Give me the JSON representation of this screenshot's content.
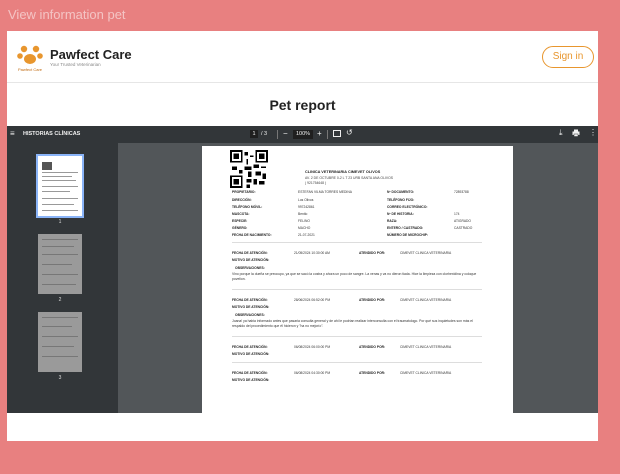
{
  "top_bar": {
    "title": "View information pet"
  },
  "header": {
    "brand": "Pawfect Care",
    "tagline": "Your Trusted Veterinarian",
    "logo_text": "Pawfect Care",
    "sign_in": "Sign in"
  },
  "page": {
    "heading": "Pet report"
  },
  "viewer": {
    "title": "HISTORIAS CLÍNICAS",
    "current_page": "1",
    "page_count": "/ 3",
    "zoom": "100%",
    "thumbs": [
      "1",
      "2",
      "3"
    ]
  },
  "doc": {
    "clinic": "CLINICA VETERINARIA CIMEVET OLIVOS",
    "address": "AV. 2 DE OCTUBRE 0-2 L T 23 URB SANTA ANA OLIVOS",
    "phone": "( 921754648 )",
    "left_fields": [
      {
        "label": "PROPIETARIO:",
        "value": "ESTEFAN VILMA TORRES MEDINA"
      },
      {
        "label": "DIRECCIÓN:",
        "value": "Los Olivos"
      },
      {
        "label": "TELÉFONO MÓVIL:",
        "value": "997242861"
      },
      {
        "label": "MASCOTA:",
        "value": "Bentlo"
      },
      {
        "label": "ESPECIE:",
        "value": "FELINO"
      },
      {
        "label": "GÉNERO:",
        "value": "MACHO"
      },
      {
        "label": "FECHA DE NACIMIENTO:",
        "value": "21-07-2021"
      }
    ],
    "right_fields": [
      {
        "label": "Nº DOCUMENTO:",
        "value": "72893788"
      },
      {
        "label": "TELÉFONO FIJO:",
        "value": ""
      },
      {
        "label": "CORREO ELECTRÓNICO:",
        "value": ""
      },
      {
        "label": "Nº DE HISTORIA:",
        "value": "174"
      },
      {
        "label": "RAZA:",
        "value": "ATIGRADO"
      },
      {
        "label": "ENTERO / CASTRADO:",
        "value": "CASTRADO"
      },
      {
        "label": "NÚMERO DE MICROCHIP:",
        "value": ""
      }
    ],
    "visits": [
      {
        "date_label": "FECHA DE ATENCIÓN:",
        "date": "21/05/2024 10:30:00 AM",
        "by_label": "ATENDIDO POR:",
        "by": "CIMEVET CLINICA VETERINARIA",
        "reason_label": "MOTIVO DE ATENCIÓN:",
        "obs_label": "OBSERVACIONES:",
        "obs": "Vino porque la dueña se preocupo, ya que se sacó la costra y ahora un poco de sangre. La venas y va no dieron tiada. Hice la limpieza con clorhexidina y coloque povelion."
      },
      {
        "date_label": "FECHA DE ATENCIÓN:",
        "date": "28/06/2024 06:52:00 PM",
        "by_label": "ATENDIDO POR:",
        "by": "CIMEVET CLINICA VETERINARIA",
        "reason_label": "MOTIVO DE ATENCIÓN:",
        "obs_label": "OBSERVACIONES:",
        "obs": "Joana! ya habia informado antes que pasaria consulta general y de ahi le podrian realizar interconsulta con el traumatologo. Por qué sus inquietudes son más el respaldo del procedimiento que él hicieron y \"ha no mejorío\"."
      },
      {
        "date_label": "FECHA DE ATENCIÓN:",
        "date": "06/08/2024 06:00:00 PM",
        "by_label": "ATENDIDO POR:",
        "by": "CIMEVET CLINICA VETERINARIA",
        "reason_label": "MOTIVO DE ATENCIÓN:"
      },
      {
        "date_label": "FECHA DE ATENCIÓN:",
        "date": "06/08/2024 04:30:00 PM",
        "by_label": "ATENDIDO POR:",
        "by": "CIMEVET CLINICA VETERINARIA",
        "reason_label": "MOTIVO DE ATENCIÓN:"
      }
    ]
  },
  "colors": {
    "background": "#e88080",
    "accent": "#e8962e",
    "viewer_bg": "#525659",
    "toolbar": "#323639"
  }
}
